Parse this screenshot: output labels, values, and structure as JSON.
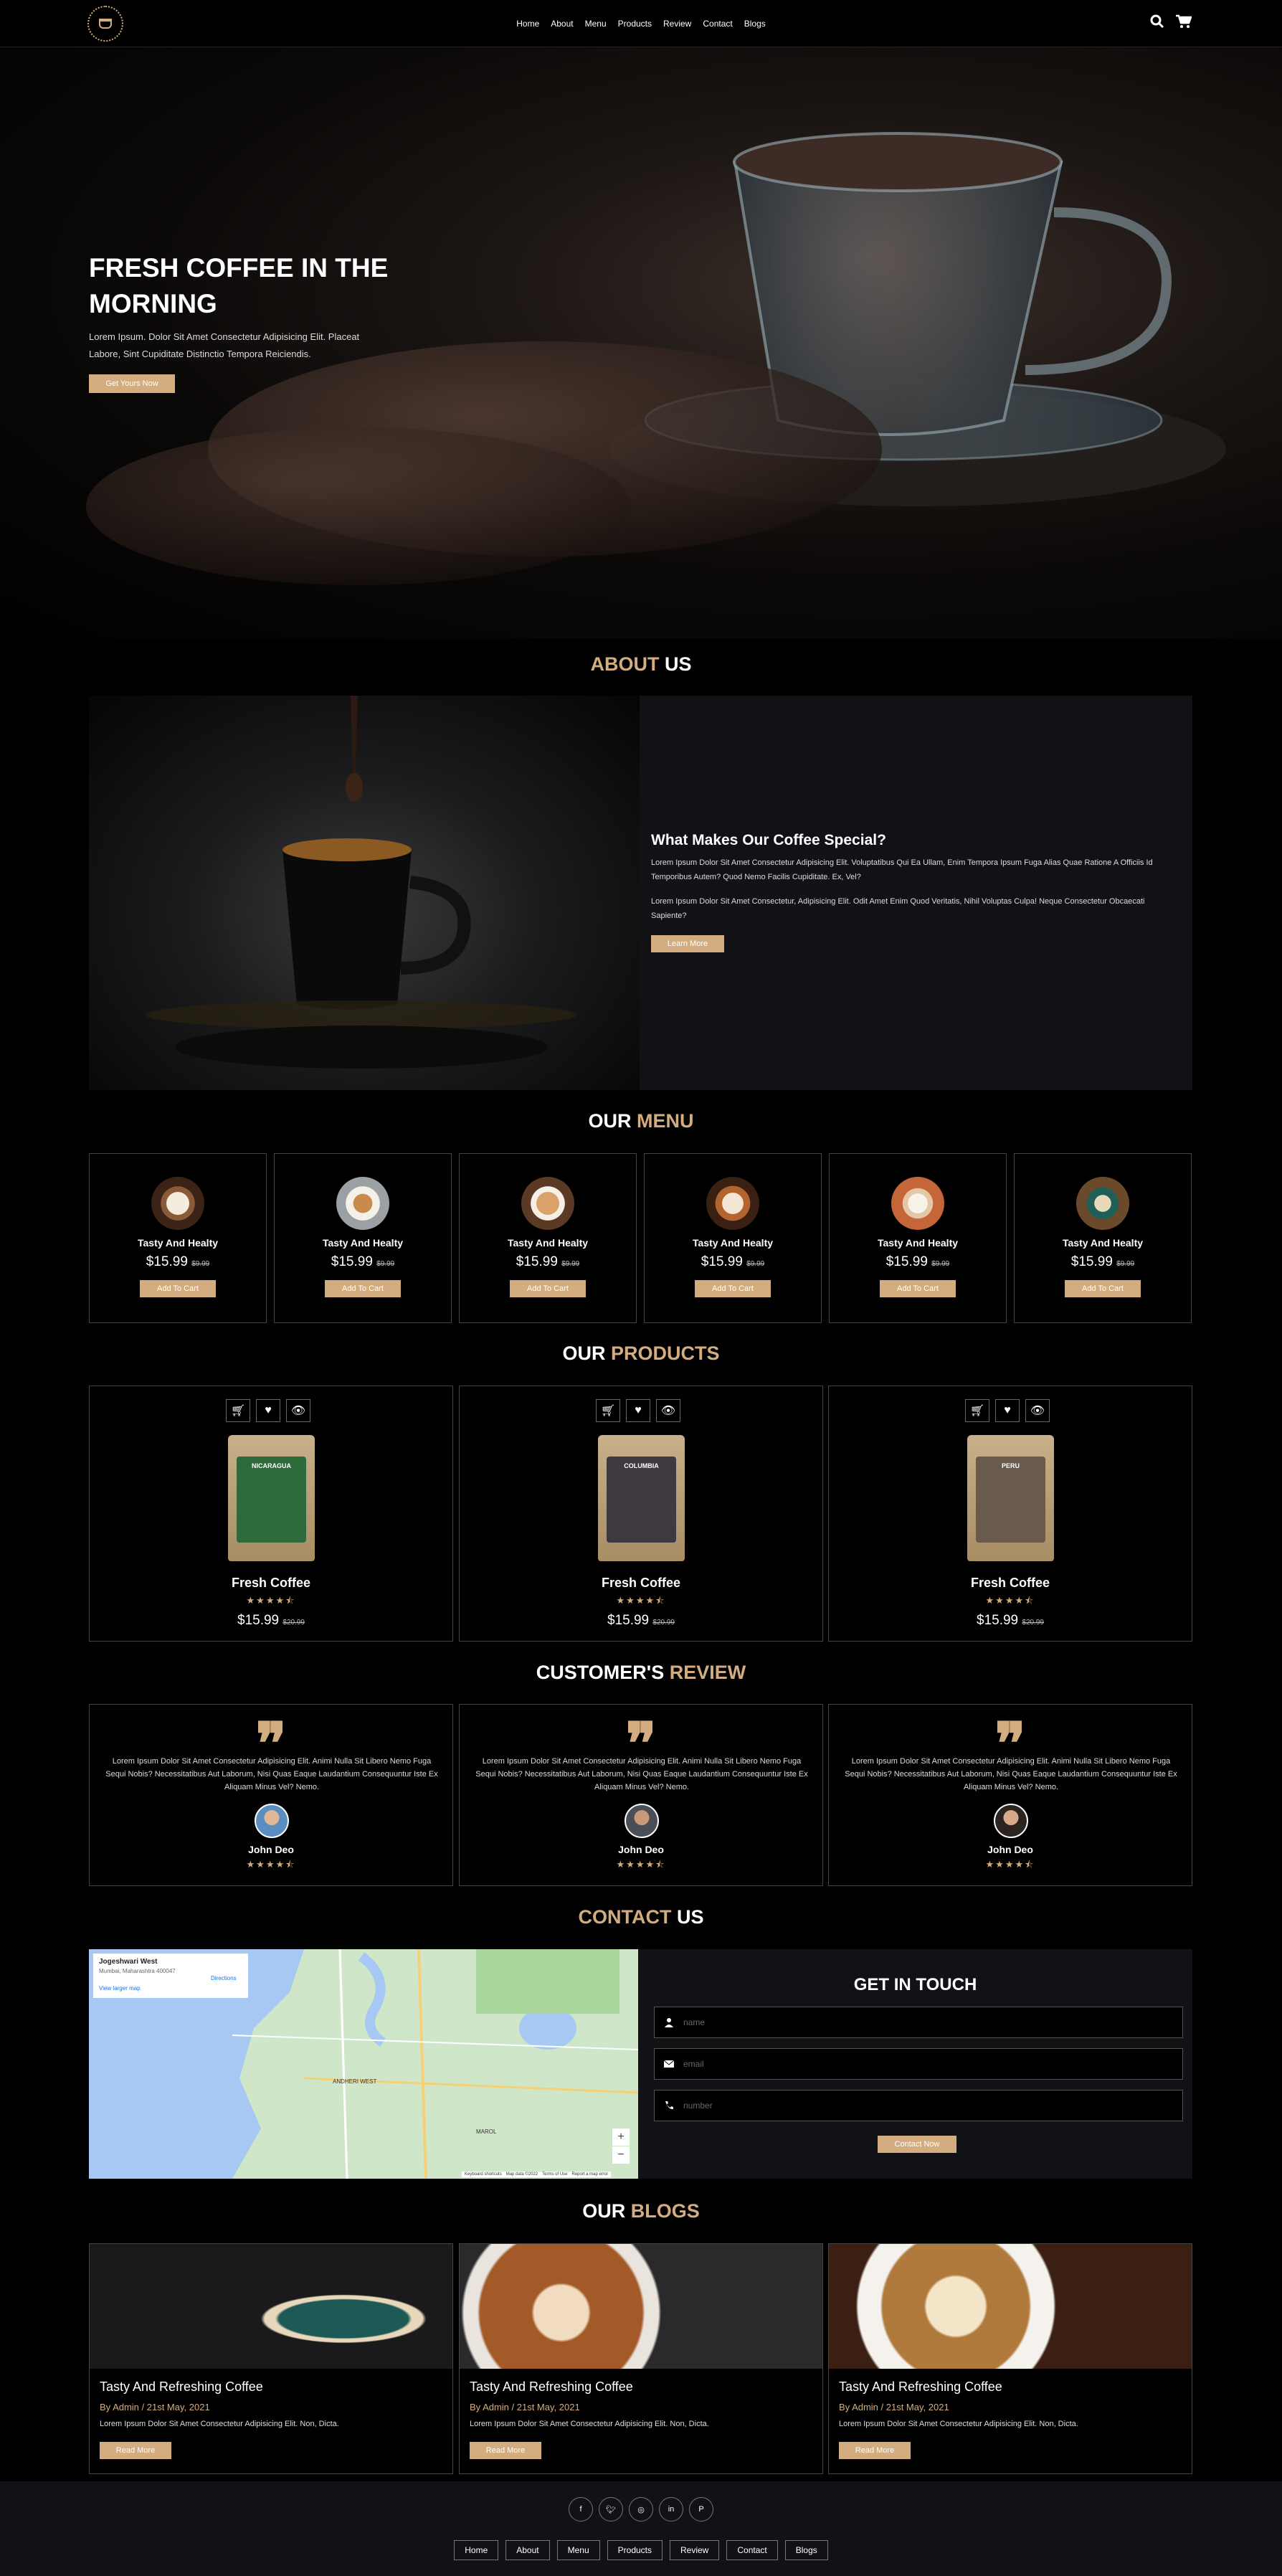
{
  "header": {
    "nav": [
      "Home",
      "About",
      "Menu",
      "Products",
      "Review",
      "Contact",
      "Blogs"
    ],
    "icons": [
      "search-icon",
      "cart-icon"
    ]
  },
  "hero": {
    "title": "FRESH COFFEE IN THE MORNING",
    "text": "Lorem Ipsum. Dolor Sit Amet Consectetur Adipisicing Elit. Placeat Labore, Sint Cupiditate Distinctio Tempora Reiciendis.",
    "cta": "Get Yours Now"
  },
  "about": {
    "heading_accent": "ABOUT",
    "heading_rest": " US",
    "title": "What Makes Our Coffee Special?",
    "p1": "Lorem Ipsum Dolor Sit Amet Consectetur Adipisicing Elit. Voluptatibus Qui Ea Ullam, Enim Tempora Ipsum Fuga Alias Quae Ratione A Officiis Id Temporibus Autem? Quod Nemo Facilis Cupiditate. Ex, Vel?",
    "p2": "Lorem Ipsum Dolor Sit Amet Consectetur, Adipisicing Elit. Odit Amet Enim Quod Veritatis, Nihil Voluptas Culpa! Neque Consectetur Obcaecati Sapiente?",
    "button": "Learn More"
  },
  "menu": {
    "heading_rest": "OUR ",
    "heading_accent": "MENU",
    "items": [
      {
        "title": "Tasty And Healty",
        "price": "$15.99",
        "old": "$9.99",
        "button": "Add To Cart"
      },
      {
        "title": "Tasty And Healty",
        "price": "$15.99",
        "old": "$9.99",
        "button": "Add To Cart"
      },
      {
        "title": "Tasty And Healty",
        "price": "$15.99",
        "old": "$9.99",
        "button": "Add To Cart"
      },
      {
        "title": "Tasty And Healty",
        "price": "$15.99",
        "old": "$9.99",
        "button": "Add To Cart"
      },
      {
        "title": "Tasty And Healty",
        "price": "$15.99",
        "old": "$9.99",
        "button": "Add To Cart"
      },
      {
        "title": "Tasty And Healty",
        "price": "$15.99",
        "old": "$9.99",
        "button": "Add To Cart"
      }
    ]
  },
  "products": {
    "heading_rest": "OUR ",
    "heading_accent": "PRODUCTS",
    "items": [
      {
        "title": "Fresh Coffee",
        "stars": "★★★★⯪",
        "rating": 4.5,
        "price": "$15.99",
        "old": "$20.99",
        "bag_label": "NICARAGUA"
      },
      {
        "title": "Fresh Coffee",
        "stars": "★★★★⯪",
        "rating": 4.5,
        "price": "$15.99",
        "old": "$20.99",
        "bag_label": "COLUMBIA"
      },
      {
        "title": "Fresh Coffee",
        "stars": "★★★★⯪",
        "rating": 4.5,
        "price": "$15.99",
        "old": "$20.99",
        "bag_label": "PERU"
      }
    ]
  },
  "reviews": {
    "heading_rest": "CUSTOMER'S ",
    "heading_accent": "REVIEW",
    "items": [
      {
        "text": "Lorem Ipsum Dolor Sit Amet Consectetur Adipisicing Elit. Animi Nulla Sit Libero Nemo Fuga Sequi Nobis? Necessitatibus Aut Laborum, Nisi Quas Eaque Laudantium Consequuntur Iste Ex Aliquam Minus Vel? Nemo.",
        "name": "John Deo",
        "stars": "★★★★⯪",
        "rating": 4.5
      },
      {
        "text": "Lorem Ipsum Dolor Sit Amet Consectetur Adipisicing Elit. Animi Nulla Sit Libero Nemo Fuga Sequi Nobis? Necessitatibus Aut Laborum, Nisi Quas Eaque Laudantium Consequuntur Iste Ex Aliquam Minus Vel? Nemo.",
        "name": "John Deo",
        "stars": "★★★★⯪",
        "rating": 4.5
      },
      {
        "text": "Lorem Ipsum Dolor Sit Amet Consectetur Adipisicing Elit. Animi Nulla Sit Libero Nemo Fuga Sequi Nobis? Necessitatibus Aut Laborum, Nisi Quas Eaque Laudantium Consequuntur Iste Ex Aliquam Minus Vel? Nemo.",
        "name": "John Deo",
        "stars": "★★★★⯪",
        "rating": 4.5
      }
    ]
  },
  "contact": {
    "heading_accent": "CONTACT",
    "heading_rest": " US",
    "map": {
      "place": "Jogeshwari West",
      "address": "Mumbai, Maharashtra 400047",
      "directions": "Directions",
      "larger": "View larger map",
      "labels": [
        "ANDHERI WEST",
        "MAROL"
      ],
      "footer": [
        "Keyboard shortcuts",
        "Map data ©2022",
        "Terms of Use",
        "Report a map error"
      ],
      "zoom_in": "+",
      "zoom_out": "−"
    },
    "form_title": "GET IN TOUCH",
    "name_ph": "name",
    "email_ph": "email",
    "number_ph": "number",
    "button": "Contact Now"
  },
  "blogs": {
    "heading_rest": "OUR ",
    "heading_accent": "BLOGS",
    "items": [
      {
        "title": "Tasty And Refreshing Coffee",
        "meta": "By Admin / 21st May, 2021",
        "desc": "Lorem Ipsum Dolor Sit Amet Consectetur Adipisicing Elit. Non, Dicta.",
        "button": "Read More"
      },
      {
        "title": "Tasty And Refreshing Coffee",
        "meta": "By Admin / 21st May, 2021",
        "desc": "Lorem Ipsum Dolor Sit Amet Consectetur Adipisicing Elit. Non, Dicta.",
        "button": "Read More"
      },
      {
        "title": "Tasty And Refreshing Coffee",
        "meta": "By Admin / 21st May, 2021",
        "desc": "Lorem Ipsum Dolor Sit Amet Consectetur Adipisicing Elit. Non, Dicta.",
        "button": "Read More"
      }
    ]
  },
  "footer": {
    "socials": [
      "facebook-icon",
      "twitter-icon",
      "instagram-icon",
      "linkedin-icon",
      "pinterest-icon"
    ],
    "links": [
      "Home",
      "About",
      "Menu",
      "Products",
      "Review",
      "Contact",
      "Blogs"
    ]
  },
  "colors": {
    "accent": "#d3ad7f",
    "panel": "#121216",
    "border": "#444444"
  }
}
